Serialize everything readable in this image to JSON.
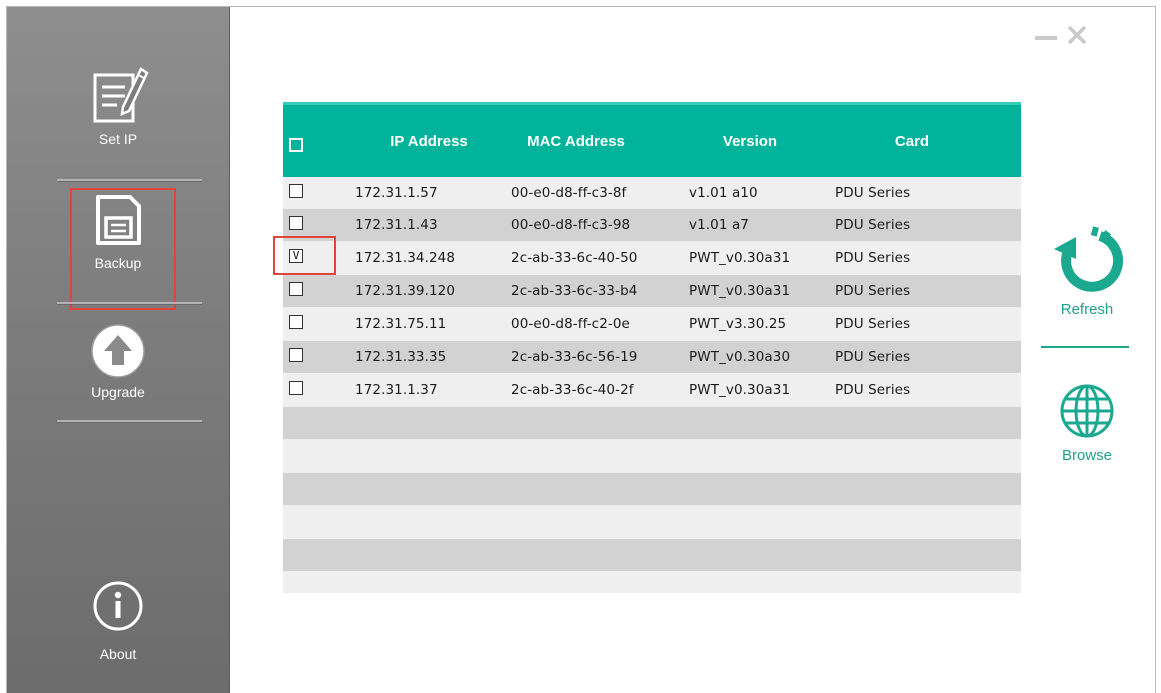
{
  "sidebar": {
    "items": [
      {
        "label": "Set IP",
        "icon": "edit-document-icon"
      },
      {
        "label": "Backup",
        "icon": "floppy-disk-icon"
      },
      {
        "label": "Upgrade",
        "icon": "upload-arrow-icon"
      },
      {
        "label": "About",
        "icon": "info-icon"
      }
    ]
  },
  "window_controls": {
    "minimize": "minimize-icon",
    "close": "close-icon"
  },
  "table": {
    "columns": [
      "IP Address",
      "MAC Address",
      "Version",
      "Card"
    ],
    "rows": [
      {
        "checked": "",
        "ip": "172.31.1.57",
        "mac": "00-e0-d8-ff-c3-8f",
        "version": "v1.01 a10",
        "card": "PDU Series"
      },
      {
        "checked": "",
        "ip": "172.31.1.43",
        "mac": "00-e0-d8-ff-c3-98",
        "version": "v1.01 a7",
        "card": "PDU Series"
      },
      {
        "checked": "V",
        "ip": "172.31.34.248",
        "mac": "2c-ab-33-6c-40-50",
        "version": "PWT_v0.30a31",
        "card": "PDU Series"
      },
      {
        "checked": "",
        "ip": "172.31.39.120",
        "mac": "2c-ab-33-6c-33-b4",
        "version": "PWT_v0.30a31",
        "card": "PDU Series"
      },
      {
        "checked": "",
        "ip": "172.31.75.11",
        "mac": "00-e0-d8-ff-c2-0e",
        "version": "PWT_v3.30.25",
        "card": "PDU Series"
      },
      {
        "checked": "",
        "ip": "172.31.33.35",
        "mac": "2c-ab-33-6c-56-19",
        "version": "PWT_v0.30a30",
        "card": "PDU Series"
      },
      {
        "checked": "",
        "ip": "172.31.1.37",
        "mac": "2c-ab-33-6c-40-2f",
        "version": "PWT_v0.30a31",
        "card": "PDU Series"
      }
    ]
  },
  "actions": {
    "refresh_label": "Refresh",
    "browse_label": "Browse"
  },
  "colors": {
    "accent": "#00b39a",
    "highlight": "#e2443c",
    "sidebar": "#7d7d7d"
  }
}
